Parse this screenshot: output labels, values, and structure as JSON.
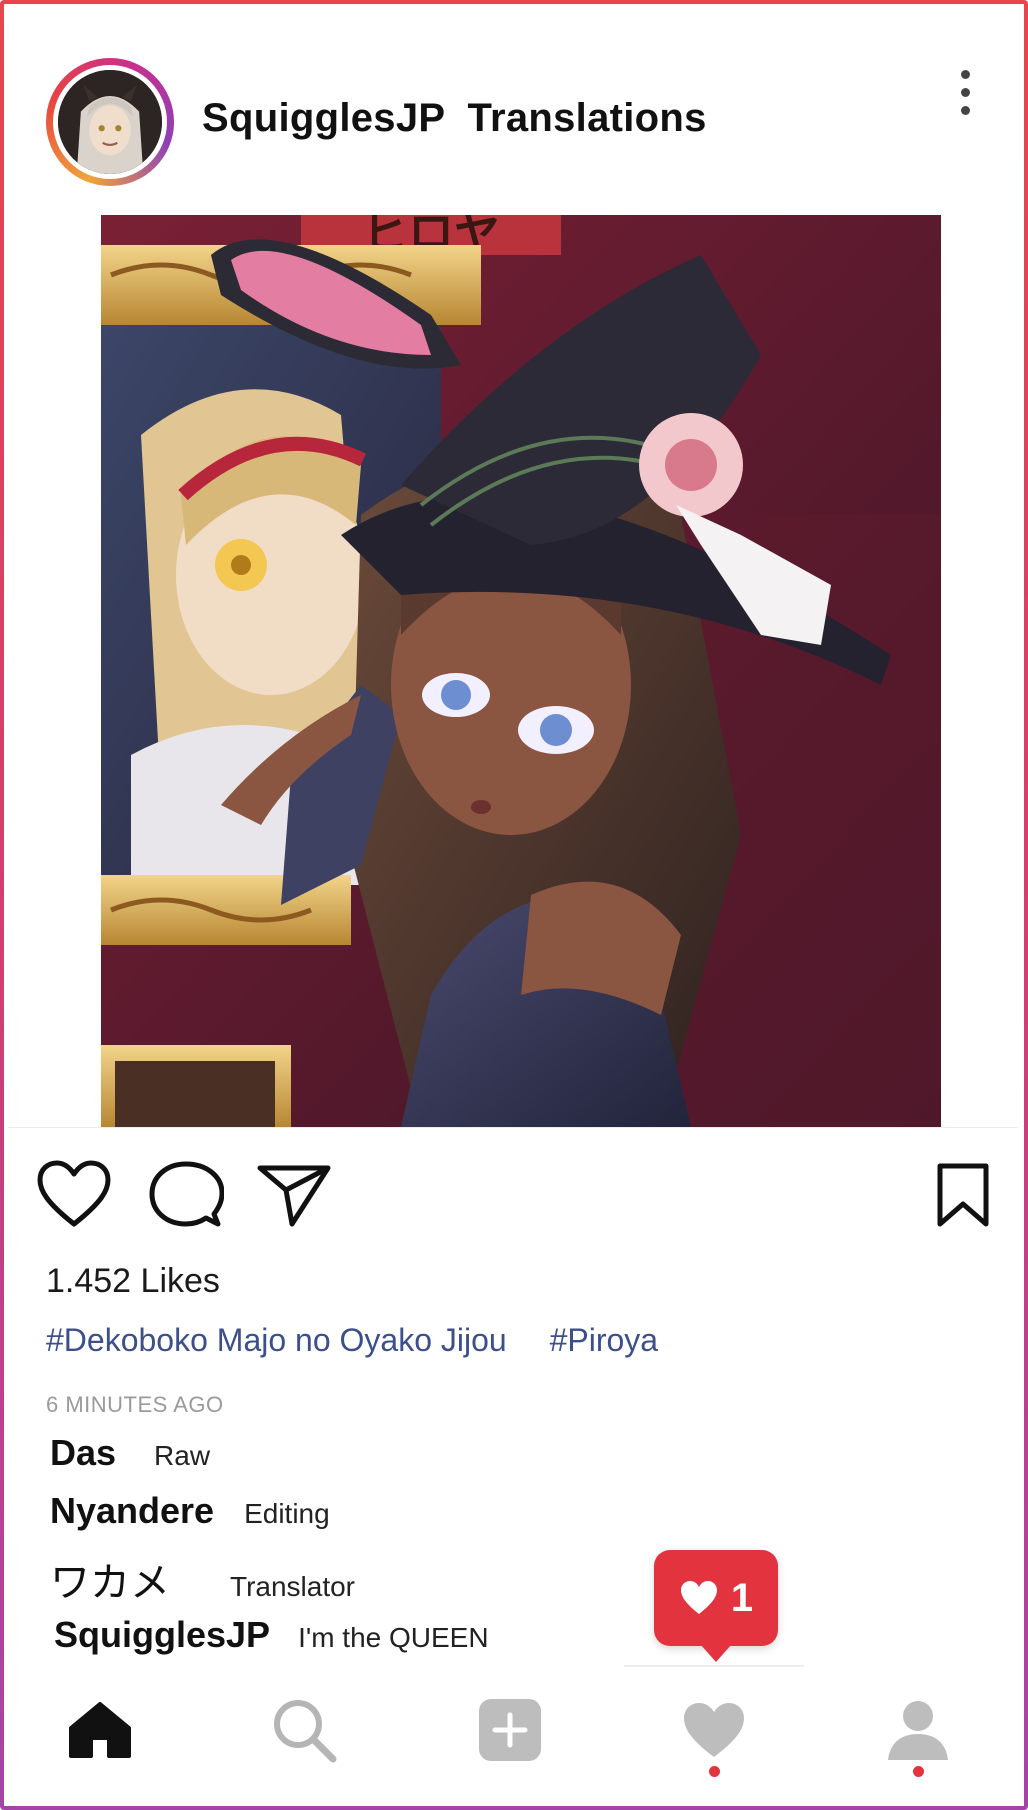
{
  "header": {
    "account_name": "SquigglesJP  Translations",
    "avatar_icon": "profile-avatar"
  },
  "post": {
    "image_title_fragment": "ヒロヤ",
    "likes_text": "1.452 Likes",
    "hashtags": [
      "#Dekoboko Majo no Oyako Jijou",
      "#Piroya"
    ],
    "timestamp": "6 MINUTES AGO",
    "credits": [
      {
        "name": "Das",
        "role": "Raw"
      },
      {
        "name": "Nyandere",
        "role": "Editing"
      },
      {
        "name": "ワカメ",
        "role": "Translator"
      },
      {
        "name": "SquigglesJP",
        "role": "I'm the QUEEN"
      }
    ]
  },
  "actions": {
    "like_icon": "heart-outline-icon",
    "comment_icon": "comment-bubble-icon",
    "share_icon": "paper-plane-icon",
    "save_icon": "bookmark-icon"
  },
  "notification": {
    "count": "1",
    "icon": "heart-icon"
  },
  "bottom_nav": [
    "home",
    "search",
    "add",
    "activity",
    "profile"
  ],
  "colors": {
    "accent_red": "#e2333f",
    "hashtag_blue": "#3c4f8a",
    "frame_top": "#e8454f",
    "frame_bottom": "#a444a8"
  }
}
